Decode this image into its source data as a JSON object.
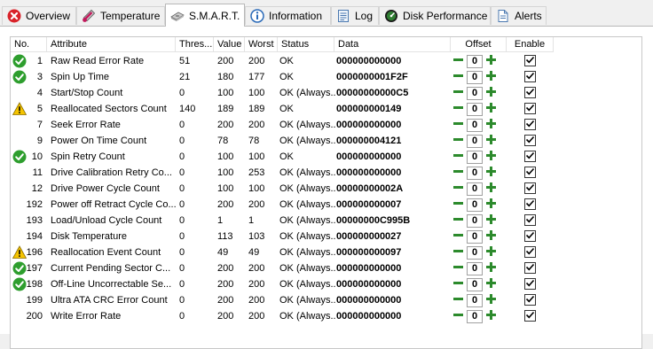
{
  "tabs": [
    {
      "label": "Overview",
      "icon": "red-close-circle-icon"
    },
    {
      "label": "Temperature",
      "icon": "thermometer-icon"
    },
    {
      "label": "S.M.A.R.T.",
      "icon": "hard-drive-icon"
    },
    {
      "label": "Information",
      "icon": "info-icon"
    },
    {
      "label": "Log",
      "icon": "log-icon"
    },
    {
      "label": "Disk Performance",
      "icon": "gauge-icon"
    },
    {
      "label": "Alerts",
      "icon": "document-alert-icon"
    }
  ],
  "active_tab": "S.M.A.R.T.",
  "columns": {
    "no": "No.",
    "attribute": "Attribute",
    "threshold": "Thres...",
    "value": "Value",
    "worst": "Worst",
    "status": "Status",
    "data": "Data",
    "offset": "Offset",
    "enable": "Enable"
  },
  "status_colors": {
    "ok": "#2e9e2e",
    "warning": "#f5c400"
  },
  "rows": [
    {
      "no": "1",
      "attribute": "Raw Read Error Rate",
      "threshold": "51",
      "value": "200",
      "worst": "200",
      "status": "OK",
      "data": "000000000000",
      "offset": "0",
      "enabled": true,
      "icon": "ok"
    },
    {
      "no": "3",
      "attribute": "Spin Up Time",
      "threshold": "21",
      "value": "180",
      "worst": "177",
      "status": "OK",
      "data": "0000000001F2F",
      "offset": "0",
      "enabled": true,
      "icon": "ok"
    },
    {
      "no": "4",
      "attribute": "Start/Stop Count",
      "threshold": "0",
      "value": "100",
      "worst": "100",
      "status": "OK (Always...",
      "data": "00000000000C5",
      "offset": "0",
      "enabled": true,
      "icon": ""
    },
    {
      "no": "5",
      "attribute": "Reallocated Sectors Count",
      "threshold": "140",
      "value": "189",
      "worst": "189",
      "status": "OK",
      "data": "000000000149",
      "offset": "0",
      "enabled": true,
      "icon": "warning"
    },
    {
      "no": "7",
      "attribute": "Seek Error Rate",
      "threshold": "0",
      "value": "200",
      "worst": "200",
      "status": "OK (Always...",
      "data": "000000000000",
      "offset": "0",
      "enabled": true,
      "icon": ""
    },
    {
      "no": "9",
      "attribute": "Power On Time Count",
      "threshold": "0",
      "value": "78",
      "worst": "78",
      "status": "OK (Always...",
      "data": "000000004121",
      "offset": "0",
      "enabled": true,
      "icon": ""
    },
    {
      "no": "10",
      "attribute": "Spin Retry Count",
      "threshold": "0",
      "value": "100",
      "worst": "100",
      "status": "OK",
      "data": "000000000000",
      "offset": "0",
      "enabled": true,
      "icon": "ok"
    },
    {
      "no": "11",
      "attribute": "Drive Calibration Retry Co...",
      "threshold": "0",
      "value": "100",
      "worst": "253",
      "status": "OK (Always...",
      "data": "000000000000",
      "offset": "0",
      "enabled": true,
      "icon": ""
    },
    {
      "no": "12",
      "attribute": "Drive Power Cycle Count",
      "threshold": "0",
      "value": "100",
      "worst": "100",
      "status": "OK (Always...",
      "data": "00000000002A",
      "offset": "0",
      "enabled": true,
      "icon": ""
    },
    {
      "no": "192",
      "attribute": "Power off Retract Cycle Co...",
      "threshold": "0",
      "value": "200",
      "worst": "200",
      "status": "OK (Always...",
      "data": "000000000007",
      "offset": "0",
      "enabled": true,
      "icon": ""
    },
    {
      "no": "193",
      "attribute": "Load/Unload Cycle Count",
      "threshold": "0",
      "value": "1",
      "worst": "1",
      "status": "OK (Always...",
      "data": "00000000C995B",
      "offset": "0",
      "enabled": true,
      "icon": ""
    },
    {
      "no": "194",
      "attribute": "Disk Temperature",
      "threshold": "0",
      "value": "113",
      "worst": "103",
      "status": "OK (Always...",
      "data": "000000000027",
      "offset": "0",
      "enabled": true,
      "icon": ""
    },
    {
      "no": "196",
      "attribute": "Reallocation Event Count",
      "threshold": "0",
      "value": "49",
      "worst": "49",
      "status": "OK (Always...",
      "data": "000000000097",
      "offset": "0",
      "enabled": true,
      "icon": "warning"
    },
    {
      "no": "197",
      "attribute": "Current Pending Sector C...",
      "threshold": "0",
      "value": "200",
      "worst": "200",
      "status": "OK (Always...",
      "data": "000000000000",
      "offset": "0",
      "enabled": true,
      "icon": "ok"
    },
    {
      "no": "198",
      "attribute": "Off-Line Uncorrectable Se...",
      "threshold": "0",
      "value": "200",
      "worst": "200",
      "status": "OK (Always...",
      "data": "000000000000",
      "offset": "0",
      "enabled": true,
      "icon": "ok"
    },
    {
      "no": "199",
      "attribute": "Ultra ATA CRC Error Count",
      "threshold": "0",
      "value": "200",
      "worst": "200",
      "status": "OK (Always...",
      "data": "000000000000",
      "offset": "0",
      "enabled": true,
      "icon": ""
    },
    {
      "no": "200",
      "attribute": "Write Error Rate",
      "threshold": "0",
      "value": "200",
      "worst": "200",
      "status": "OK (Always...",
      "data": "000000000000",
      "offset": "0",
      "enabled": true,
      "icon": ""
    }
  ]
}
